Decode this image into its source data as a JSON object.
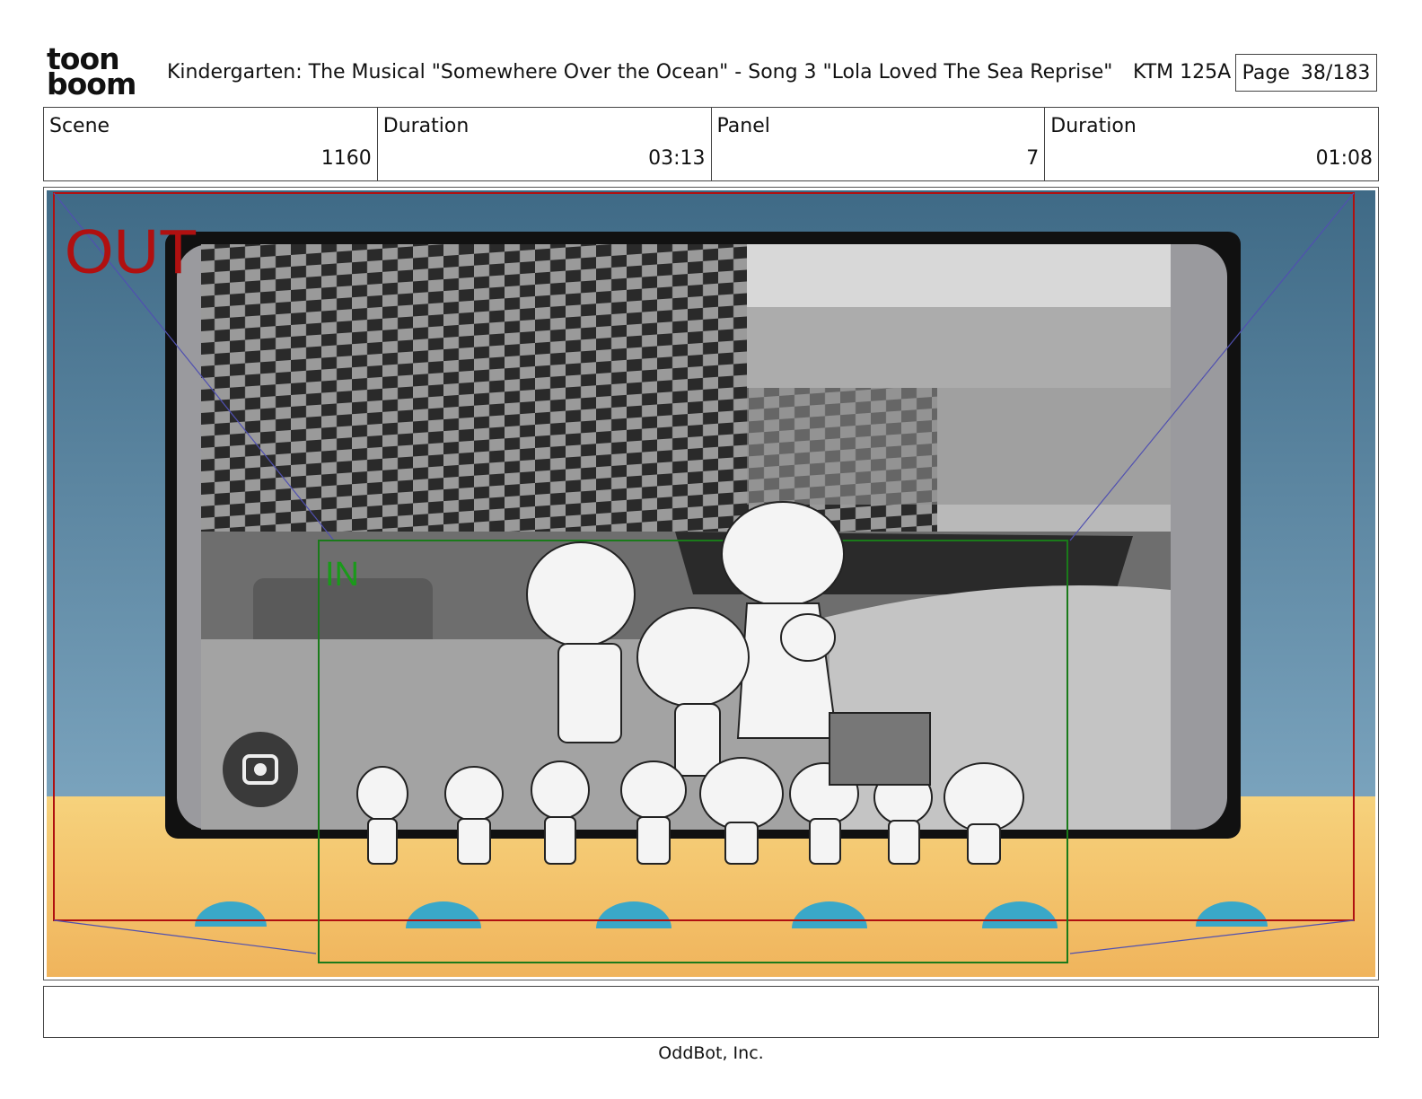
{
  "logo": {
    "line1": "toon",
    "line2": "boom"
  },
  "header": {
    "title": "Kindergarten: The Musical  \"Somewhere Over the Ocean\" - Song 3 \"Lola Loved The Sea Reprise\"",
    "code": "KTM 125A",
    "page_label": "Page",
    "page_value": "38/183"
  },
  "info": {
    "scene_label": "Scene",
    "scene_value": "1160",
    "duration_label": "Duration",
    "duration_value": "03:13",
    "panel_label": "Panel",
    "panel_value": "7",
    "panel_duration_label": "Duration",
    "panel_duration_value": "01:08"
  },
  "panel": {
    "out_label": "OUT",
    "in_label": "IN",
    "lens_icon": "lens-camera-icon"
  },
  "colors": {
    "frame_red": "#b01010",
    "frame_green": "#1a8a1a",
    "sky": "#5e8aa6",
    "stage": "#f2c46a",
    "shell": "#3aa8c8"
  },
  "footer": {
    "company": "OddBot, Inc."
  }
}
